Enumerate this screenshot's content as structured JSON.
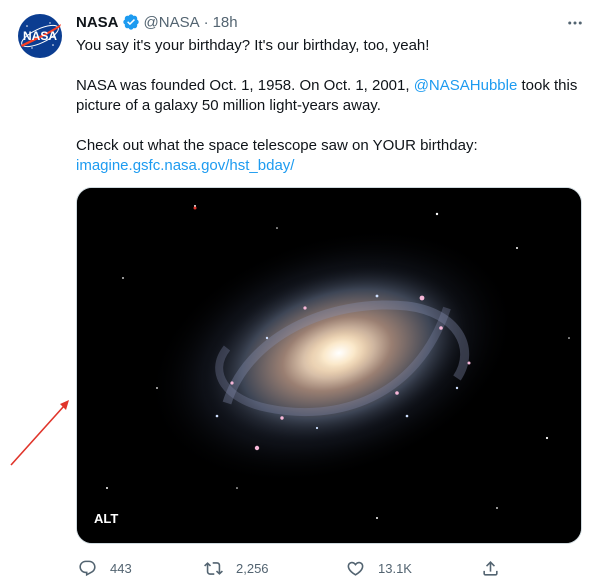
{
  "tweet": {
    "author_name": "NASA",
    "handle": "@NASA",
    "separator": "·",
    "time": "18h",
    "avatar_text": "NASA",
    "line1": "You say it's your birthday? It's our birthday, too, yeah!",
    "line2_before": "NASA was founded Oct. 1, 1958. On Oct. 1, 2001, ",
    "line2_mention": "@NASAHubble",
    "line2_after": " took this picture of a galaxy 50 million light-years away.",
    "line3": "Check out what the space telescope saw on YOUR birthday:",
    "link": "imagine.gsfc.nasa.gov/hst_bday/",
    "alt_label": "ALT",
    "replies": "443",
    "retweets": "2,256",
    "likes": "13.1K"
  },
  "colors": {
    "link": "#1d9bf0",
    "secondary_text": "#536471",
    "verified_badge": "#1d9bf0",
    "annotation_arrow": "#e0342a",
    "nasa_blue": "#0b3d91",
    "nasa_red": "#fc3d21"
  },
  "icons": [
    "more-icon",
    "verified-icon",
    "reply-icon",
    "retweet-icon",
    "like-icon",
    "share-icon"
  ]
}
